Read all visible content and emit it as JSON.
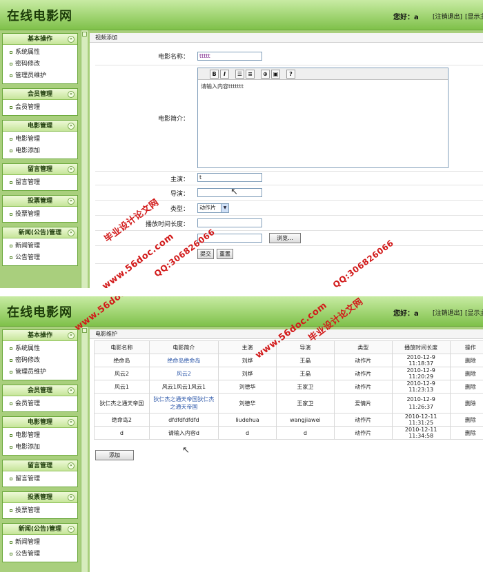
{
  "header": {
    "title": "在线电影网",
    "greeting": "您好：a",
    "logout": "[注销退出]",
    "show": "[显示主"
  },
  "sidebar": [
    {
      "title": "基本操作",
      "items": [
        "系统属性",
        "密码修改",
        "管理员维护"
      ]
    },
    {
      "title": "会员管理",
      "items": [
        "会员管理"
      ]
    },
    {
      "title": "电影管理",
      "items": [
        "电影管理",
        "电影添加"
      ]
    },
    {
      "title": "留言管理",
      "items": [
        "留言管理"
      ]
    },
    {
      "title": "投票管理",
      "items": [
        "投票管理"
      ]
    },
    {
      "title": "新闻(公告)管理",
      "items": [
        "新闻管理",
        "公告管理"
      ]
    }
  ],
  "toggle_glyph": "«",
  "form": {
    "panel_title": "视频添加",
    "movie_name_label": "电影名称：",
    "movie_name_value": "ttttt",
    "intro_label": "电影简介：",
    "intro_value": "请输入内容ttttttt",
    "actor_label": "主演：",
    "actor_value": "t",
    "director_label": "导演：",
    "director_value": "",
    "type_label": "类型：",
    "type_value": "动作片",
    "duration_label": "播放时间长度：",
    "browse_label": "浏览...",
    "submit_label": "提交",
    "reset_label": "重置",
    "toolbar": {
      "bold": "B",
      "italic": "I",
      "help": "?"
    }
  },
  "list": {
    "panel_title": "电影维护",
    "columns": [
      "电影名称",
      "电影简介",
      "主演",
      "导演",
      "类型",
      "播放时间长度",
      "操作"
    ],
    "rows": [
      [
        "绝命岛",
        "绝命岛绝命岛",
        "刘烨",
        "王晶",
        "动作片",
        "2010-12-9 11:18:37",
        "删除"
      ],
      [
        "风云2",
        "风云2",
        "刘烨",
        "王晶",
        "动作片",
        "2010-12-9 11:20:29",
        "删除"
      ],
      [
        "风云1",
        "风云1风云1风云1",
        "刘德华",
        "王家卫",
        "动作片",
        "2010-12-9 11:23:13",
        "删除"
      ],
      [
        "狄仁杰之通天帝国",
        "狄仁杰之通天帝国狄仁杰之通天帝国",
        "刘德华",
        "王家卫",
        "爱情片",
        "2010-12-9 11:26:37",
        "删除"
      ],
      [
        "绝命岛2",
        "dfdfdfdfdfd",
        "liudehua",
        "wangjiawei",
        "动作片",
        "2010-12-11 11:31:25",
        "删除"
      ],
      [
        "d",
        "请输入内容d",
        "d",
        "d",
        "动作片",
        "2010-12-11 11:34:58",
        "删除"
      ]
    ],
    "add_label": "添加"
  },
  "watermarks": {
    "site": "www.56doc.com",
    "qq": "QQ:306826066",
    "name": "毕业设计论文网"
  },
  "colors": {
    "header_green": "#7fc14a",
    "frame_green": "#a9cf7d",
    "link_blue": "#2a55a8",
    "watermark_red": "#d21a1a"
  }
}
